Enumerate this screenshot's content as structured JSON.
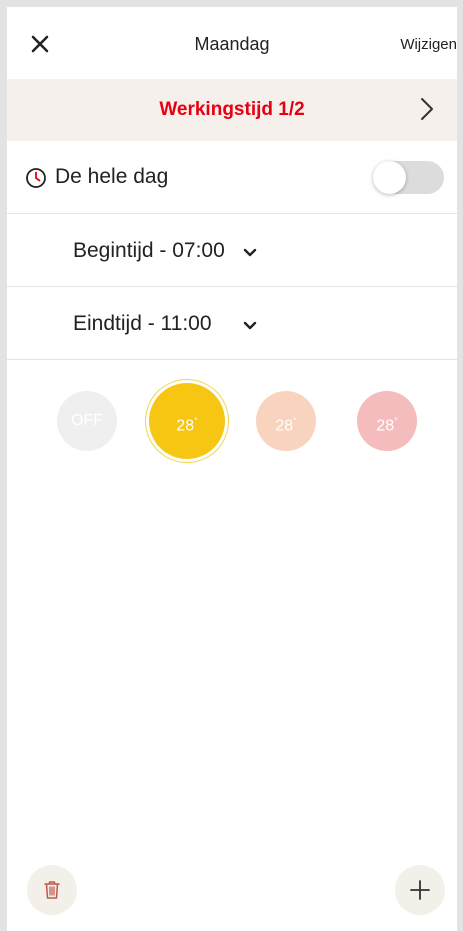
{
  "header": {
    "title": "Maandag",
    "edit_label": "Wijzigen",
    "close_icon": "close-icon"
  },
  "schedule": {
    "title": "Werkingstijd 1/2",
    "title_color": "#e60012",
    "next_icon": "chevron-right-icon"
  },
  "all_day": {
    "label": "De hele dag",
    "icon": "clock-icon",
    "toggle_on": false
  },
  "start_time": {
    "label": "Begintijd - 07:00",
    "icon": "chevron-down-icon"
  },
  "end_time": {
    "label": "Eindtijd - 11:00",
    "icon": "chevron-down-icon"
  },
  "modes": [
    {
      "label": "OFF",
      "unit": "",
      "color": "#efefef",
      "selected": false
    },
    {
      "label": "28",
      "unit": "°",
      "color": "#f7c613",
      "selected": true
    },
    {
      "label": "28",
      "unit": "°",
      "color": "#f8d3bd",
      "selected": false
    },
    {
      "label": "28",
      "unit": "°",
      "color": "#f4bcbc",
      "selected": false
    }
  ],
  "footer": {
    "delete_icon": "trash-icon",
    "add_icon": "plus-icon"
  }
}
